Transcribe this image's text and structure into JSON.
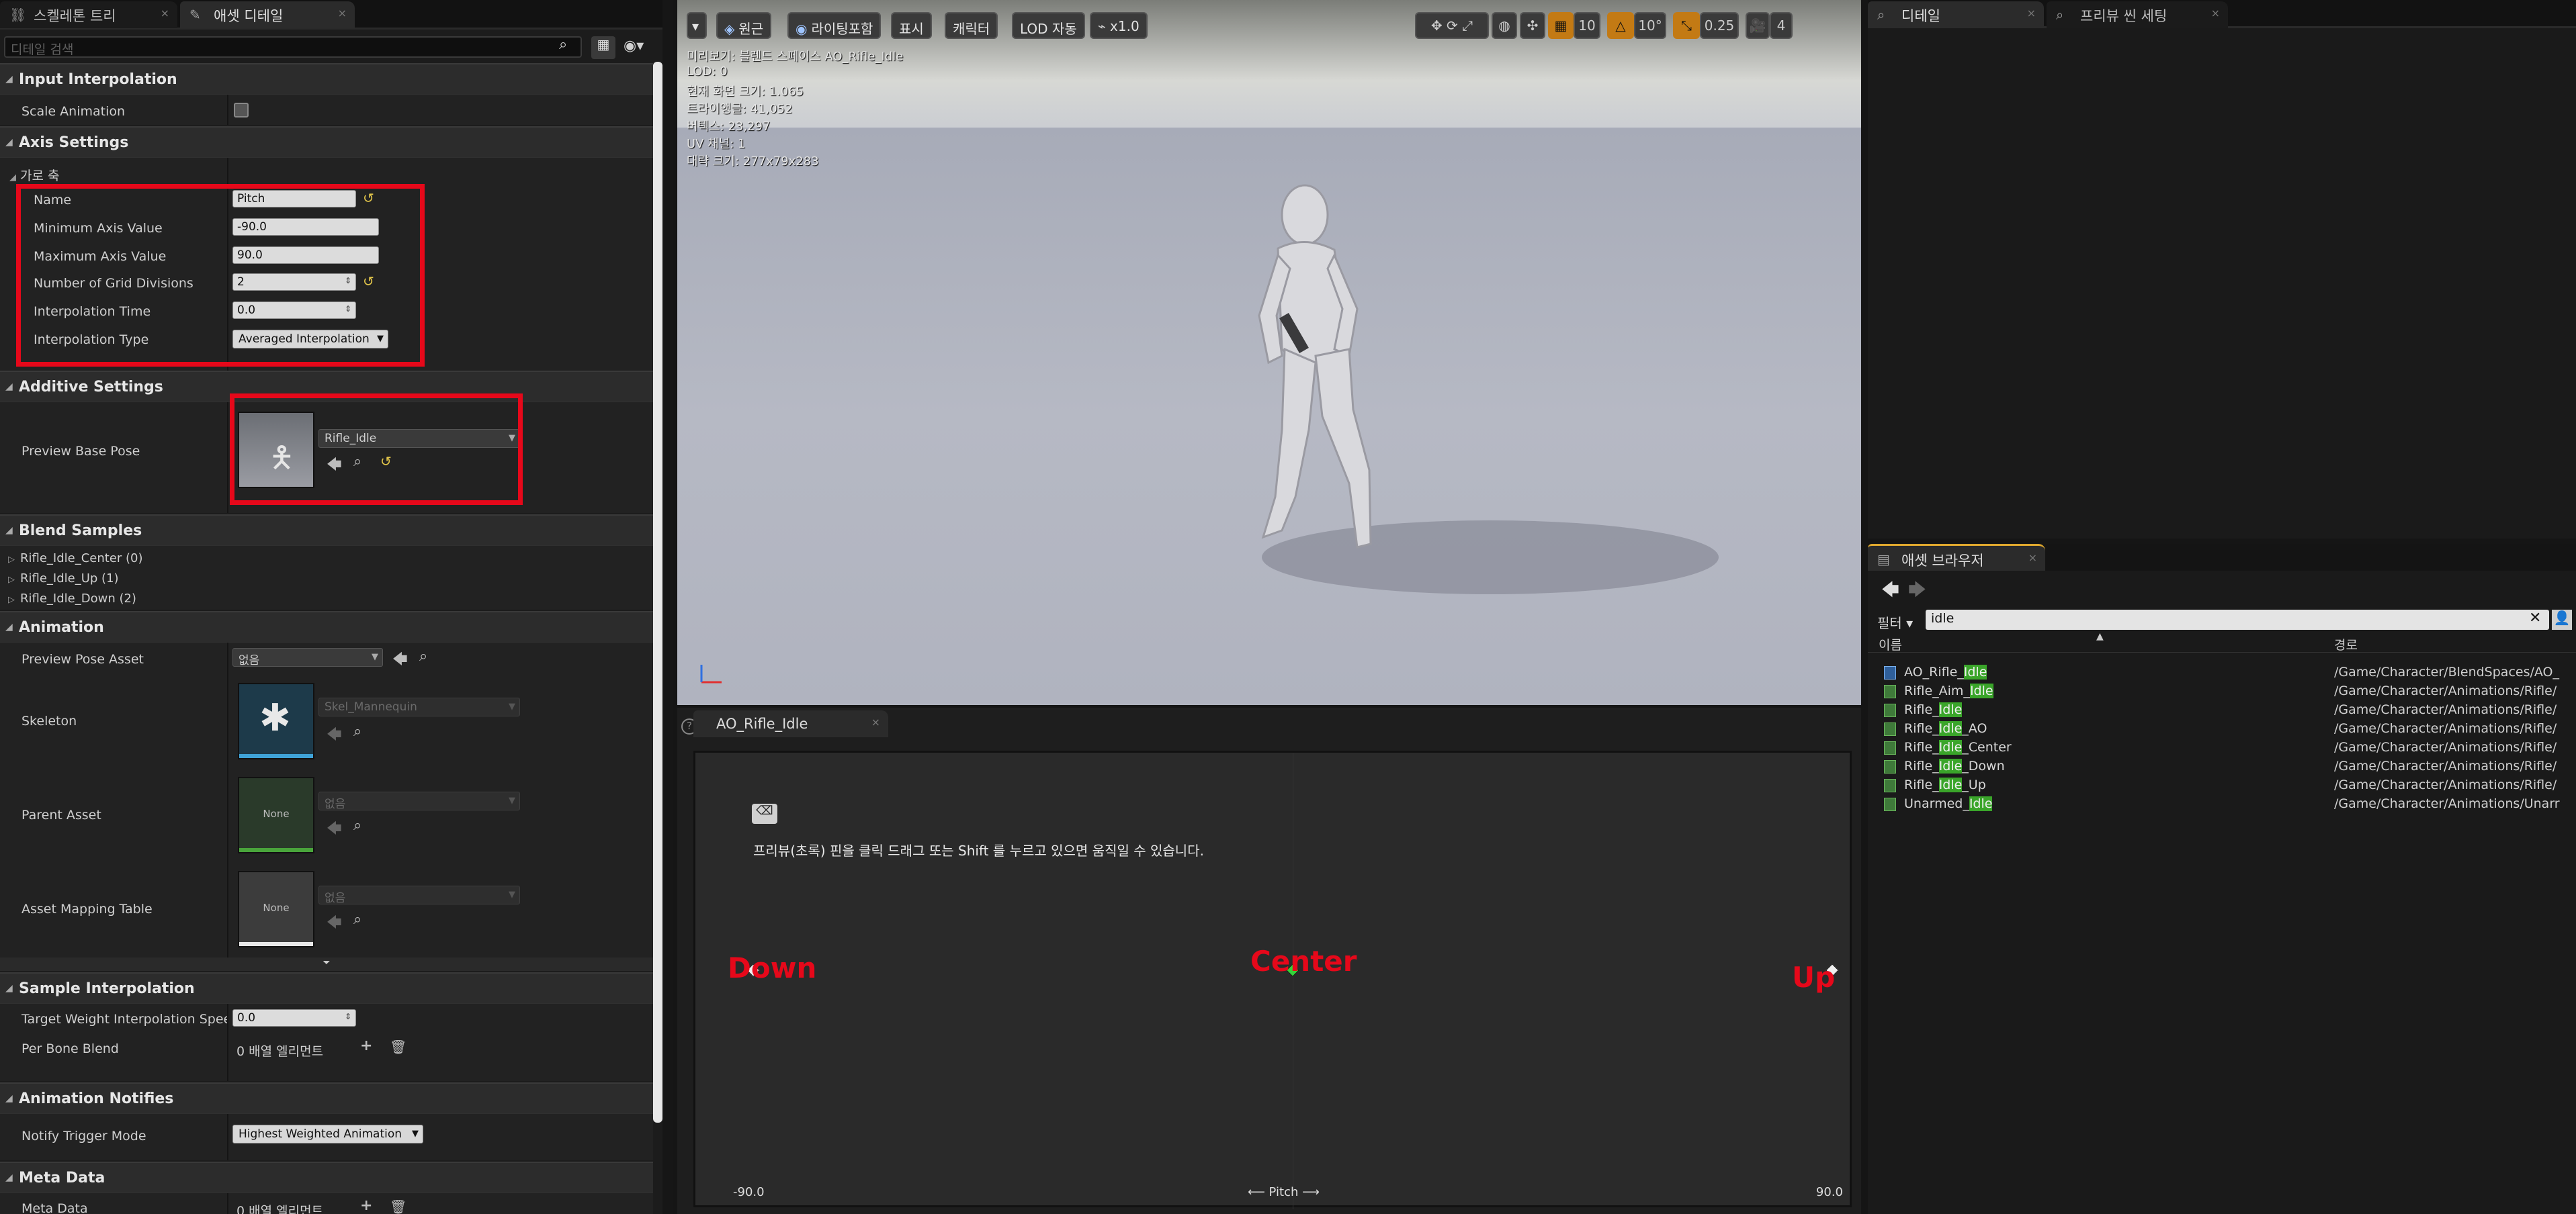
{
  "left_panel": {
    "tabs": [
      {
        "label": "스켈레톤 트리"
      },
      {
        "label": "애셋 디테일"
      }
    ],
    "search_placeholder": "디테일 검색",
    "sections": {
      "input_interpolation": {
        "title": "Input Interpolation",
        "scale_animation": {
          "label": "Scale Animation",
          "checked": false
        }
      },
      "axis_settings": {
        "title": "Axis Settings",
        "horizontal_axis": "가로 축",
        "name": {
          "label": "Name",
          "value": "Pitch"
        },
        "min": {
          "label": "Minimum Axis Value",
          "value": "-90.0"
        },
        "max": {
          "label": "Maximum Axis Value",
          "value": "90.0"
        },
        "grid": {
          "label": "Number of Grid Divisions",
          "value": "2"
        },
        "interp_time": {
          "label": "Interpolation Time",
          "value": "0.0"
        },
        "interp_type": {
          "label": "Interpolation Type",
          "value": "Averaged Interpolation"
        }
      },
      "additive": {
        "title": "Additive Settings",
        "preview_base_pose": {
          "label": "Preview Base Pose",
          "value": "Rifle_Idle"
        }
      },
      "blend_samples": {
        "title": "Blend Samples",
        "items": [
          "Rifle_Idle_Center (0)",
          "Rifle_Idle_Up (1)",
          "Rifle_Idle_Down (2)"
        ]
      },
      "animation": {
        "title": "Animation",
        "preview_pose_asset": {
          "label": "Preview Pose Asset",
          "value": "없음"
        },
        "skeleton": {
          "label": "Skeleton",
          "value": "Skel_Mannequin"
        },
        "parent_asset": {
          "label": "Parent Asset",
          "value": "없음",
          "thumb": "None"
        },
        "asset_mapping": {
          "label": "Asset Mapping Table",
          "value": "없음",
          "thumb": "None"
        }
      },
      "sample_interp": {
        "title": "Sample Interpolation",
        "target_weight": {
          "label": "Target Weight Interpolation Speed P",
          "value": "0.0"
        },
        "per_bone": {
          "label": "Per Bone Blend",
          "value": "0 배열 엘리먼트"
        }
      },
      "notifies": {
        "title": "Animation Notifies",
        "trigger": {
          "label": "Notify Trigger Mode",
          "value": "Highest Weighted Animation"
        }
      },
      "meta": {
        "title": "Meta Data",
        "meta_data": {
          "label": "Meta Data",
          "value": "0 배열 엘리먼트"
        }
      }
    }
  },
  "viewport": {
    "toolbar": {
      "perspective": "원근",
      "lighting": "라이팅포함",
      "show": "표시",
      "character": "캐릭터",
      "lod": "LOD 자동",
      "speed": "x1.0",
      "grid_size": "10",
      "rotation_snap": "10°",
      "scale_snap": "0.25",
      "camera_speed": "4"
    },
    "info_lines": [
      "미리보기: 블렌드 스페이스 AO_Rifle_Idle",
      "LOD: 0",
      "현재 화면 크기: 1.065",
      "트라이앵글: 41,052",
      "버텍스: 23,297",
      "UV 채널: 1",
      "대략 크기: 277x79x283"
    ]
  },
  "blend_editor": {
    "tab": "AO_Rifle_Idle",
    "hint": "프리뷰(초록) 핀을 클릭 드래그 또는 Shift 를 누르고 있으면 움직일 수 있습니다.",
    "axis_min": "-90.0",
    "axis_max": "90.0",
    "axis_name": "Pitch",
    "annotations": {
      "down": "Down",
      "center": "Center",
      "up": "Up"
    },
    "samples": [
      {
        "name": "Down",
        "value": -90
      },
      {
        "name": "Center",
        "value": 0
      },
      {
        "name": "Up",
        "value": 90
      }
    ],
    "preview_value": 0
  },
  "right_panels": {
    "tabs": [
      {
        "label": "디테일"
      },
      {
        "label": "프리뷰 씬 세팅"
      }
    ],
    "asset_browser": {
      "tab": "애셋 브라우저",
      "filter_label": "필터",
      "search_value": "idle",
      "col_name": "이름",
      "col_path": "경로",
      "rows": [
        {
          "pre": "AO_Rifle_",
          "hl": "Idle",
          "post": "",
          "path": "/Game/Character/BlendSpaces/AO_"
        },
        {
          "pre": "Rifle_Aim_",
          "hl": "Idle",
          "post": "",
          "path": "/Game/Character/Animations/Rifle/"
        },
        {
          "pre": "Rifle_",
          "hl": "Idle",
          "post": "",
          "path": "/Game/Character/Animations/Rifle/"
        },
        {
          "pre": "Rifle_",
          "hl": "Idle",
          "post": "_AO",
          "path": "/Game/Character/Animations/Rifle/"
        },
        {
          "pre": "Rifle_",
          "hl": "Idle",
          "post": "_Center",
          "path": "/Game/Character/Animations/Rifle/"
        },
        {
          "pre": "Rifle_",
          "hl": "Idle",
          "post": "_Down",
          "path": "/Game/Character/Animations/Rifle/"
        },
        {
          "pre": "Rifle_",
          "hl": "Idle",
          "post": "_Up",
          "path": "/Game/Character/Animations/Rifle/"
        },
        {
          "pre": "Unarmed_",
          "hl": "Idle",
          "post": "",
          "path": "/Game/Character/Animations/Unarr"
        }
      ]
    }
  },
  "colors": {
    "highlight_red": "#e6081a",
    "match_green": "#3aa52a",
    "preview_pin": "#36d33a"
  }
}
